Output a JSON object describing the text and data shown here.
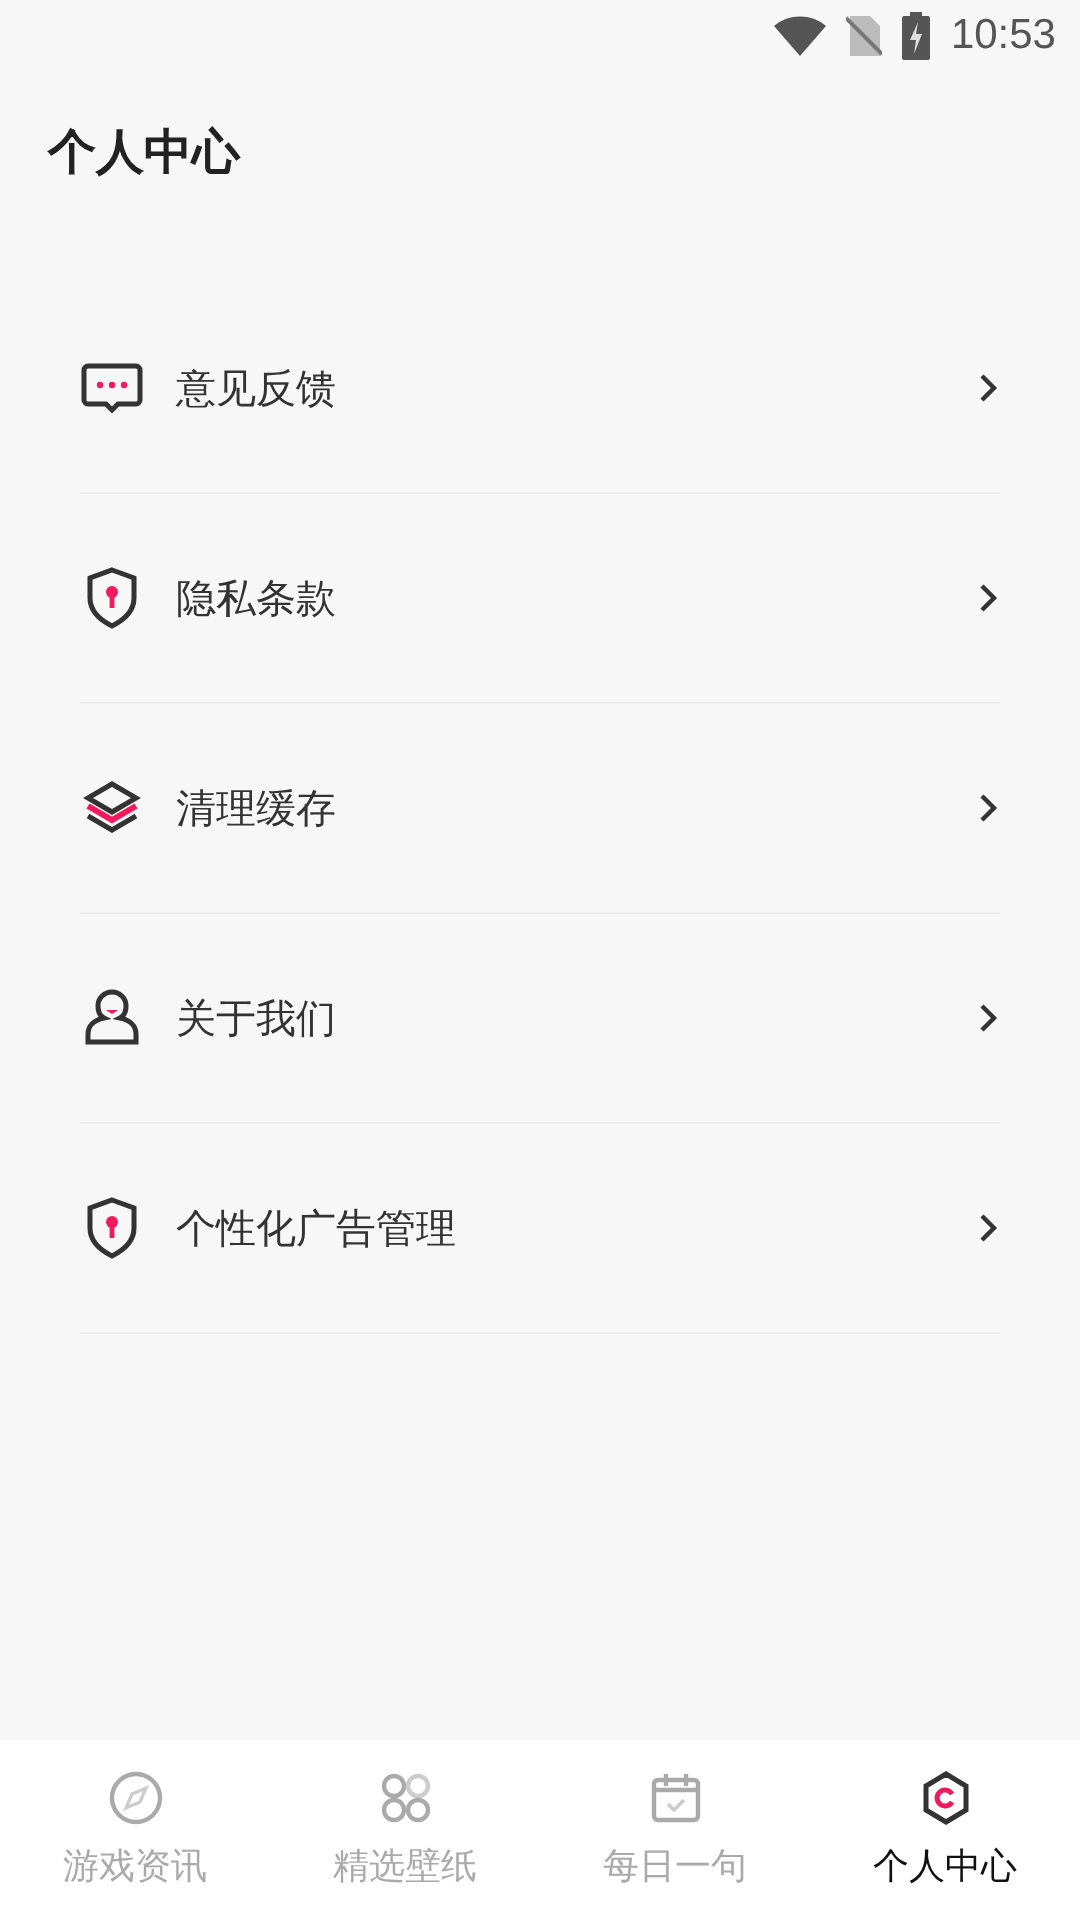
{
  "status_bar": {
    "time": "10:53"
  },
  "header": {
    "title": "个人中心"
  },
  "menu": [
    {
      "kind": "feedback",
      "label": "意见反馈"
    },
    {
      "kind": "shield",
      "label": "隐私条款"
    },
    {
      "kind": "layers",
      "label": "清理缓存"
    },
    {
      "kind": "person",
      "label": "关于我们"
    },
    {
      "kind": "shield",
      "label": "个性化广告管理"
    }
  ],
  "tabs": [
    {
      "kind": "compass",
      "label": "游戏资讯",
      "selected": false
    },
    {
      "kind": "clover",
      "label": "精选壁纸",
      "selected": false
    },
    {
      "kind": "calendar",
      "label": "每日一句",
      "selected": false
    },
    {
      "kind": "hexagon",
      "label": "个人中心",
      "selected": true
    }
  ]
}
